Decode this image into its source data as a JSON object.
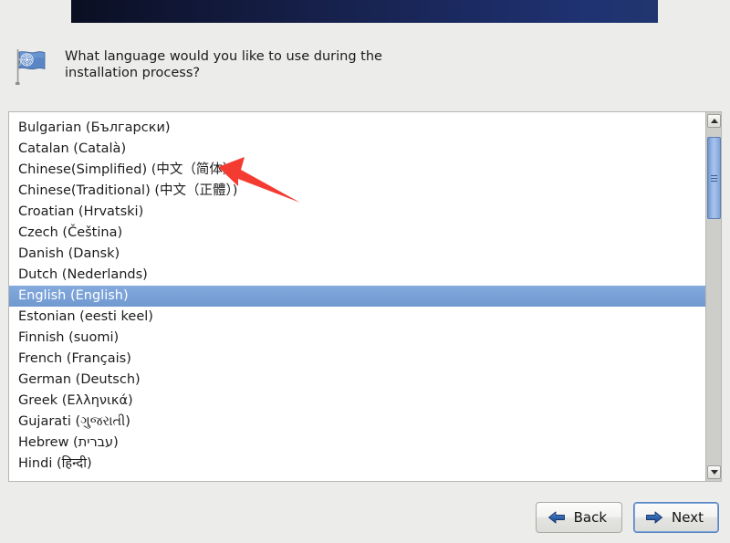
{
  "banner": {
    "name": "installer-banner",
    "gradient_from": "#0a0f22",
    "gradient_to": "#21366f"
  },
  "question": {
    "icon": "un-flag-icon",
    "text": "What language would you like to use during the\ninstallation process?"
  },
  "language_list": {
    "selected_value": "English (English)",
    "items": [
      "Bulgarian (Български)",
      "Catalan (Català)",
      "Chinese(Simplified) (中文（简体）)",
      "Chinese(Traditional) (中文（正體）)",
      "Croatian (Hrvatski)",
      "Czech (Čeština)",
      "Danish (Dansk)",
      "Dutch (Nederlands)",
      "English (English)",
      "Estonian (eesti keel)",
      "Finnish (suomi)",
      "French (Français)",
      "German (Deutsch)",
      "Greek (Ελληνικά)",
      "Gujarati (ગુજરાતી)",
      "Hebrew (עברית)",
      "Hindi (हिन्दी)"
    ],
    "selection_color": "#7ba3d9",
    "selection_text_color": "#ffffff"
  },
  "scrollbar": {
    "up_arrow": "chevron-up-icon",
    "down_arrow": "chevron-down-icon",
    "thumb_color": "#9dbbe8",
    "track_color": "#cdcdca"
  },
  "buttons": {
    "back": {
      "label": "Back",
      "icon": "arrow-left-icon",
      "focused": false
    },
    "next": {
      "label": "Next",
      "icon": "arrow-right-icon",
      "focused": true
    }
  },
  "annotation": {
    "arrow_color": "#f43b32",
    "points_to": "Chinese(Simplified) (中文（简体）)"
  }
}
